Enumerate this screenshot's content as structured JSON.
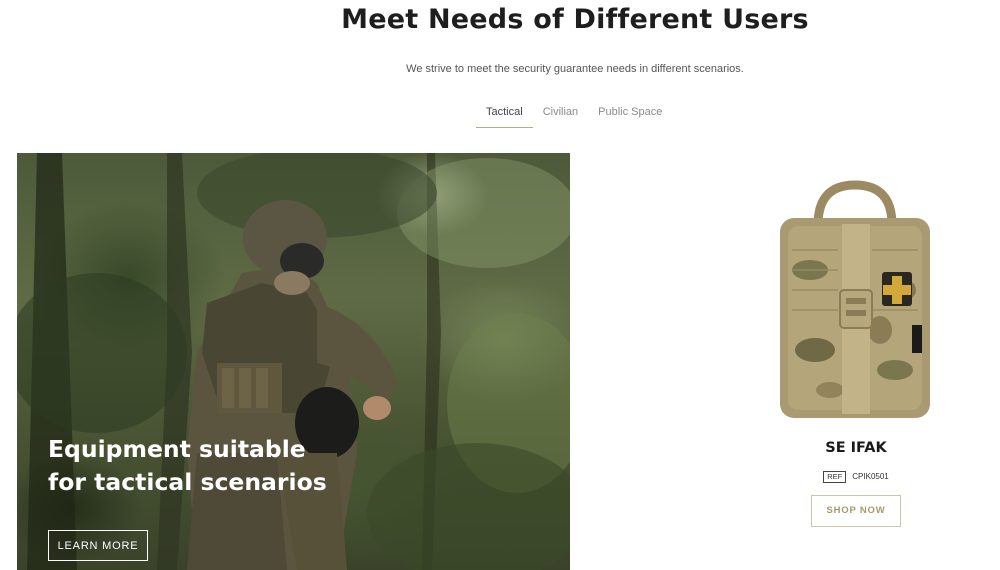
{
  "section": {
    "title": "Meet Needs of Different Users",
    "subtitle": "We strive to meet the security guarantee needs in different scenarios."
  },
  "tabs": [
    {
      "label": "Tactical",
      "active": true
    },
    {
      "label": "Civilian",
      "active": false
    },
    {
      "label": "Public Space",
      "active": false
    }
  ],
  "hero": {
    "headline": "Equipment suitable\nfor tactical scenarios",
    "button_label": "LEARN MORE"
  },
  "product": {
    "name": "SE IFAK",
    "ref_label": "REF",
    "ref_code": "CPIK0501",
    "button_label": "SHOP NOW"
  },
  "colors": {
    "accent": "#b8ab84",
    "shop_text": "#a89a6c"
  }
}
